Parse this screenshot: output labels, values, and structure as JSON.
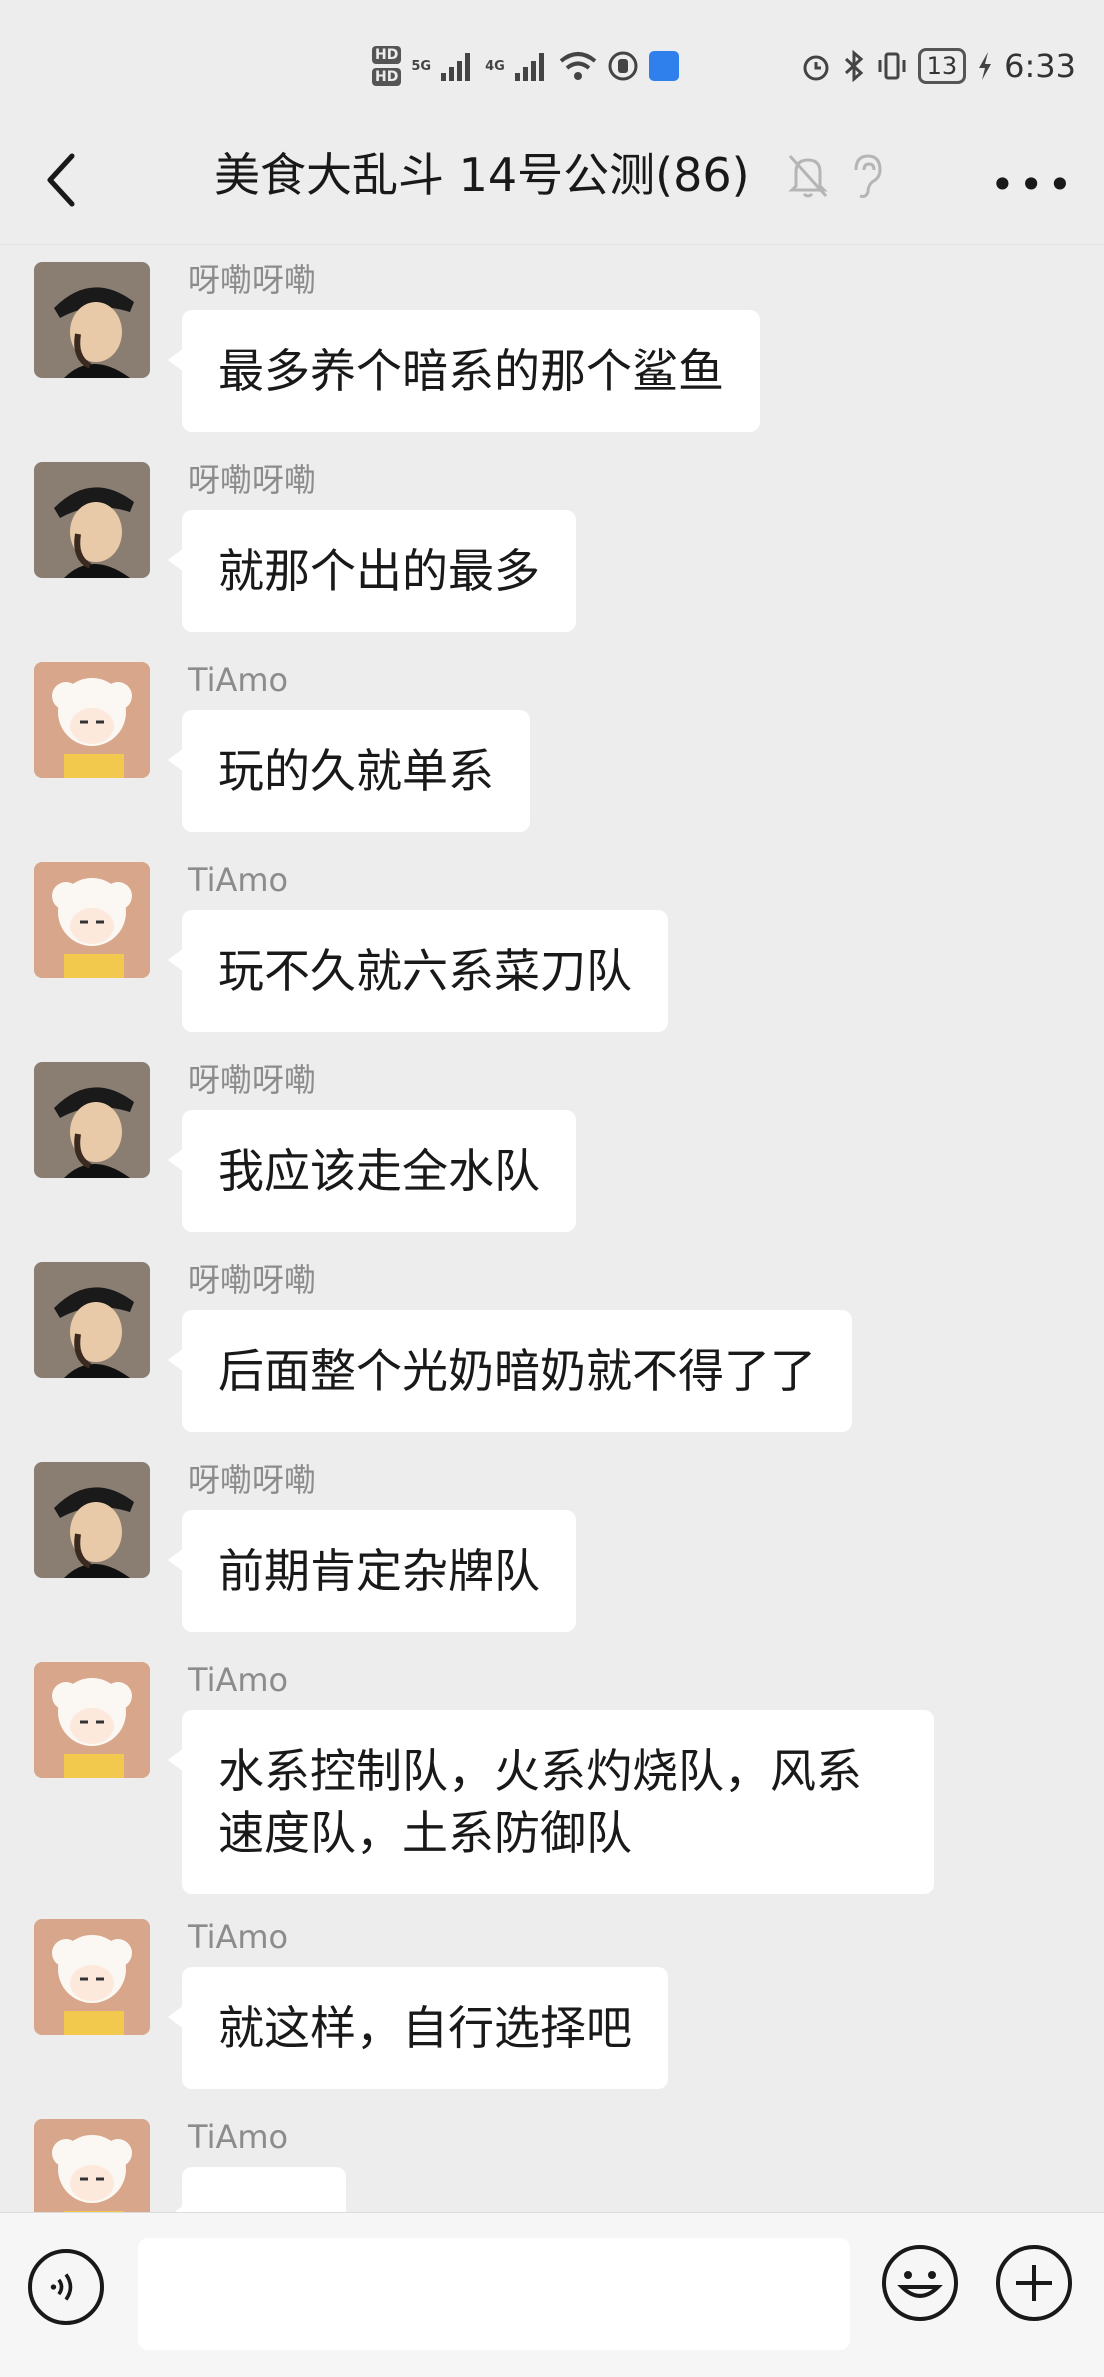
{
  "status_bar": {
    "hd1": "HD",
    "hd2": "HD",
    "net1": "5G",
    "net2": "4G",
    "battery": "13",
    "time": "6:33"
  },
  "header": {
    "title": "美食大乱斗 14号公测(86)"
  },
  "messages": [
    {
      "sender": "呀嘞呀嘞",
      "avatar": "man-cap-avatar",
      "text": "最多养个暗系的那个鲨鱼"
    },
    {
      "sender": "呀嘞呀嘞",
      "avatar": "man-cap-avatar",
      "text": "就那个出的最多"
    },
    {
      "sender": "TiAmo",
      "avatar": "sheep-avatar",
      "text": "玩的久就单系"
    },
    {
      "sender": "TiAmo",
      "avatar": "sheep-avatar",
      "text": "玩不久就六系菜刀队"
    },
    {
      "sender": "呀嘞呀嘞",
      "avatar": "man-cap-avatar",
      "text": "我应该走全水队"
    },
    {
      "sender": "呀嘞呀嘞",
      "avatar": "man-cap-avatar",
      "text": "后面整个光奶暗奶就不得了了"
    },
    {
      "sender": "呀嘞呀嘞",
      "avatar": "man-cap-avatar",
      "text": "前期肯定杂牌队"
    },
    {
      "sender": "TiAmo",
      "avatar": "sheep-avatar",
      "text": "水系控制队，火系灼烧队，风系速度队，土系防御队"
    },
    {
      "sender": "TiAmo",
      "avatar": "sheep-avatar",
      "text": "就这样，自行选择吧"
    },
    {
      "sender": "TiAmo",
      "avatar": "sheep-avatar",
      "text": "……"
    }
  ],
  "colors": {
    "background": "#ededed",
    "bubble": "#ffffff",
    "name_text": "#8c8c8c"
  },
  "icons": [
    "back-arrow-icon",
    "mute-bell-icon",
    "ear-icon",
    "more-icon",
    "voice-icon",
    "emoji-icon",
    "plus-icon"
  ]
}
